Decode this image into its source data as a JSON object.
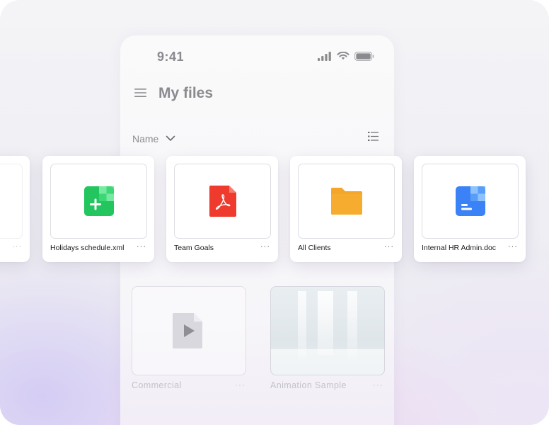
{
  "status_bar": {
    "time": "9:41"
  },
  "header": {
    "title": "My files"
  },
  "sort": {
    "label": "Name"
  },
  "cards": [
    {
      "name": "",
      "more": "···"
    },
    {
      "name": "Holidays schedule.xml",
      "more": "···",
      "icon": "spreadsheet-icon",
      "color": "#22c55e"
    },
    {
      "name": "Team Goals",
      "more": "···",
      "icon": "pdf-icon",
      "color": "#ef3b2d"
    },
    {
      "name": "All Clients",
      "more": "···",
      "icon": "folder-icon",
      "color": "#f5a52a"
    },
    {
      "name": "Internal HR Admin.doc",
      "more": "···",
      "icon": "document-icon",
      "color": "#3b82f6"
    }
  ],
  "background_files": [
    {
      "name": "Commercial",
      "more": "···",
      "icon": "video-file-icon"
    },
    {
      "name": "Animation Sample",
      "more": "···"
    }
  ]
}
